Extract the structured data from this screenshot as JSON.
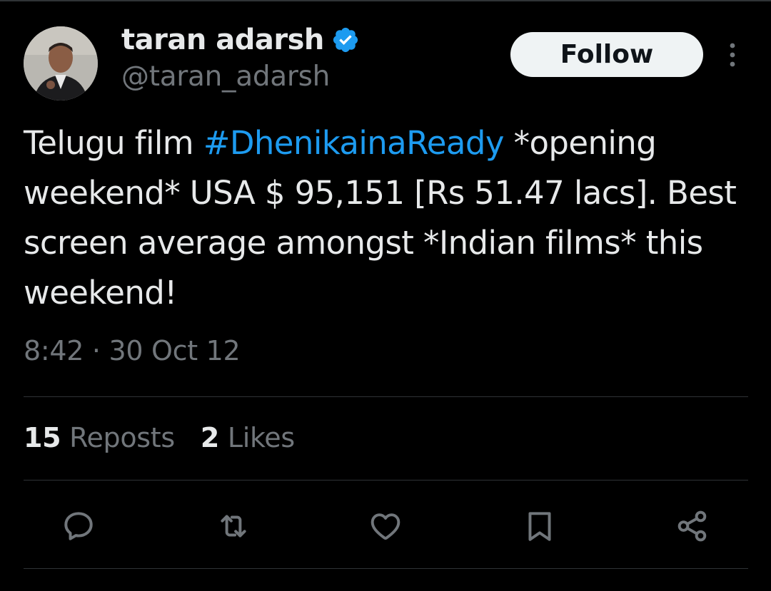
{
  "author": {
    "display_name": "taran adarsh",
    "handle": "@taran_adarsh",
    "verified": true,
    "verified_color": "#1d9bf0"
  },
  "header": {
    "follow_label": "Follow",
    "more_icon": "more-vertical-icon"
  },
  "tweet": {
    "text_before": "Telugu film ",
    "hashtag": "#DhenikainaReady",
    "text_after": " *opening weekend* USA $ 95,151 [Rs 51.47 lacs]. Best screen average amongst *Indian films* this weekend!",
    "hashtag_color": "#1d9bf0",
    "timestamp": "8:42 · 30 Oct 12"
  },
  "stats": {
    "reposts_count": "15",
    "reposts_label": "Reposts",
    "likes_count": "2",
    "likes_label": "Likes"
  },
  "actions": [
    "reply-icon",
    "repost-icon",
    "like-icon",
    "bookmark-icon",
    "share-icon"
  ],
  "colors": {
    "background": "#000000",
    "text_primary": "#e7e9ea",
    "text_secondary": "#71767b",
    "divider": "#2f3336",
    "follow_bg": "#eff3f4"
  }
}
